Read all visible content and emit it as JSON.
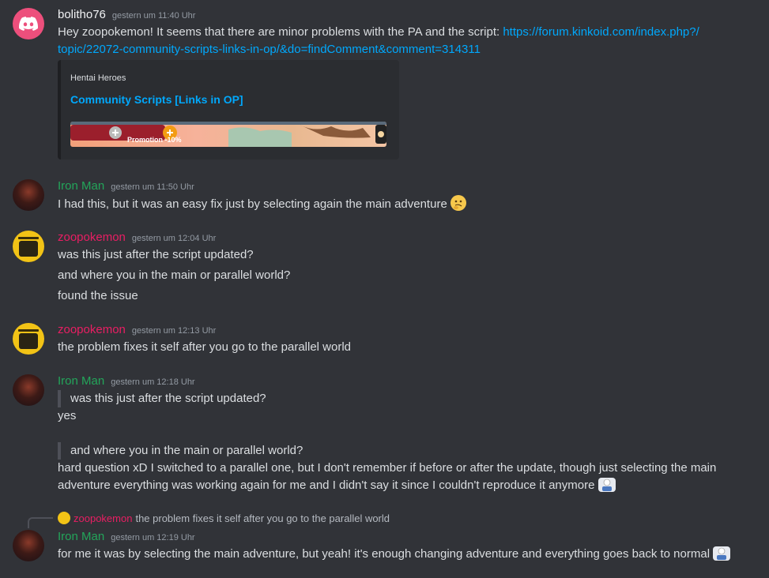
{
  "colors": {
    "background": "#313338",
    "link": "#00a8fc",
    "iron_man": "#23a55a",
    "zoopokemon": "#e91e63",
    "bolitho": "#f2f3f5"
  },
  "messages": [
    {
      "author": "bolitho76",
      "timestamp": "gestern um 11:40 Uhr",
      "text_prefix": "Hey zoopokemon! It seems that there are minor problems with the PA and the script: ",
      "link_line1": "https://forum.kinkoid.com/index.php?/",
      "link_line2": "topic/22072-community-scripts-links-in-op/&do=findComment&comment=314311",
      "embed": {
        "provider": "Hentai Heroes",
        "title": "Community Scripts [Links in OP]",
        "image_caption": "Promotion -10%"
      }
    },
    {
      "author": "Iron Man",
      "timestamp": "gestern um 11:50 Uhr",
      "text": "I had this, but it was an easy fix just by selecting again the main adventure"
    },
    {
      "author": "zoopokemon",
      "timestamp": "gestern um 12:04 Uhr",
      "lines": [
        "was this just after the script updated?",
        "and where you in the main or parallel world?",
        "found the issue"
      ]
    },
    {
      "author": "zoopokemon",
      "timestamp": "gestern um 12:13 Uhr",
      "text": "the problem fixes it self after you go to the parallel world"
    },
    {
      "author": "Iron Man",
      "timestamp": "gestern um 12:18 Uhr",
      "quote1": "was this just after the script updated?",
      "answer1": "yes",
      "quote2": "and where you in the main or parallel world?",
      "answer2_line1": "hard question xD I switched to a parallel one, but I don't remember if before or after the update, though just selecting the main",
      "answer2_line2": "adventure everything was working again for me and I didn't say it since I couldn't reproduce it anymore"
    },
    {
      "reply_to_author": "zoopokemon",
      "reply_to_text": "the problem fixes it self after you go to the parallel world",
      "author": "Iron Man",
      "timestamp": "gestern um 12:19 Uhr",
      "text": "for me it was by selecting the main adventure, but yeah! it's enough changing adventure and everything goes back to normal"
    }
  ]
}
